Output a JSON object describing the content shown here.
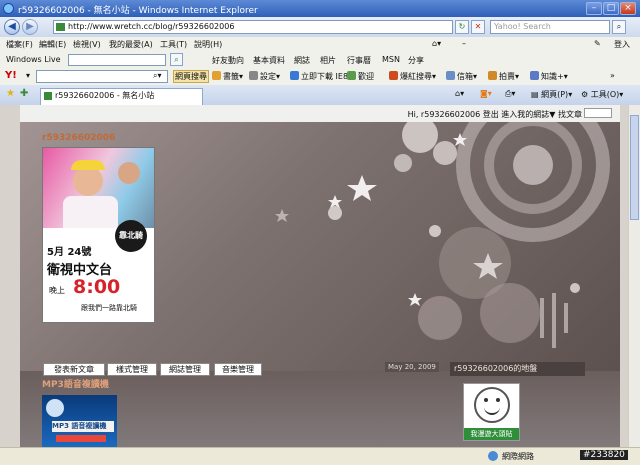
{
  "window": {
    "title": "r59326602006 - 無名小站 - Windows Internet Explorer"
  },
  "address": {
    "url": "http://www.wretch.cc/blog/r59326602006"
  },
  "search": {
    "placeholder": "Yahoo! Search"
  },
  "menu": {
    "items": [
      "檔案(F)",
      "編輯(E)",
      "檢視(V)",
      "我的最愛(A)",
      "工具(T)",
      "說明(H)"
    ],
    "right_items": [
      "好友動向",
      "基本資料",
      "網誌",
      "相片",
      "行事曆",
      "MSN",
      "分享"
    ],
    "signin": "登入"
  },
  "live": {
    "label": "Windows Live"
  },
  "yahoo": {
    "logo": "Y!",
    "web_search": "網頁搜尋",
    "bookmark": "書籤",
    "settings": "設定",
    "ie8_download": "立即下載 IE8",
    "news": "歡迎",
    "hot": "爆紅搜尋",
    "mail": "信箱",
    "auction": "拍賣",
    "knowledge": "知識+"
  },
  "tab": {
    "label": "r59326602006 - 無名小站",
    "page_menu": "網頁(P)",
    "tools_menu": "工具(O)"
  },
  "page": {
    "userbar": "Hi, r59326602006  登出  進入我的網誌▼  找文章",
    "blog_title": "r59326602006",
    "poster": {
      "date": "5月 24號",
      "channel": "衛視中文台",
      "time_label": "晚上",
      "time": "8:00",
      "tagline": "跟我們一路靠北騎",
      "badge": "靠北騎"
    },
    "buttons": [
      "發表新文章",
      "樣式管理",
      "網誌管理",
      "音樂管理"
    ],
    "date": "May 20, 2009",
    "sidebar_title": "r59326602006的地盤",
    "player_title": "MP3語音複讀機",
    "widget_label": "我漫遊大頭貼",
    "mp3_label": "MP3 語音複讀機"
  },
  "status": {
    "zone": "網際網路",
    "watermark": "#233820"
  },
  "colors": {
    "accent": "#2e5fb8",
    "banner": "#7e7270",
    "title_orange": "#c06a3a"
  }
}
